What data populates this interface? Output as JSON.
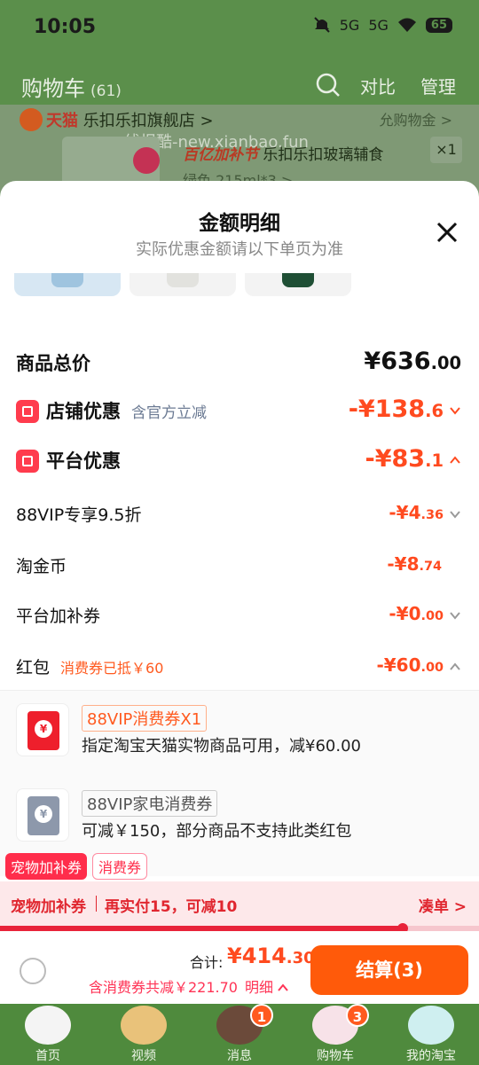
{
  "status_bar": {
    "time": "10:05",
    "signal1": "5G",
    "signal2": "5G",
    "battery": "65"
  },
  "header": {
    "title": "购物车",
    "count": "(61)",
    "compare": "对比",
    "manage": "管理"
  },
  "background_item": {
    "store_brand": "天猫",
    "store_name": "乐扣乐扣旗舰店 >",
    "right_text": "允购物金 >",
    "watermark": "线报酷-new.xianbao.fun",
    "promo": "百亿加补节",
    "product": "乐扣乐扣玻璃辅食",
    "sku": "绿色 215ml*3 >",
    "qty": "×1"
  },
  "sheet": {
    "title": "金额明细",
    "subtitle": "实际优惠金额请以下单页为准",
    "rows": {
      "total": {
        "label": "商品总价",
        "value_int": "¥636",
        "value_dec": ".00"
      },
      "store": {
        "label": "店铺优惠",
        "note": "含官方立减",
        "value_int": "-¥138",
        "value_dec": ".6"
      },
      "platform": {
        "label": "平台优惠",
        "value_int": "-¥83",
        "value_dec": ".1"
      },
      "vip": {
        "label": "88VIP专享9.5折",
        "value_int": "-¥4",
        "value_dec": ".36"
      },
      "coin": {
        "label": "淘金币",
        "value_int": "-¥8",
        "value_dec": ".74"
      },
      "subsidy": {
        "label": "平台加补券",
        "value_int": "-¥0",
        "value_dec": ".00"
      },
      "redpacket": {
        "label": "红包",
        "note": "消费券已抵￥60",
        "value_int": "-¥60",
        "value_dec": ".00"
      }
    },
    "coupons": [
      {
        "tag": "88VIP消费券X1",
        "desc": "指定淘宝天猫实物商品可用，减¥60.00"
      },
      {
        "tag": "88VIP家电消费券",
        "desc": "可减￥150，部分商品不支持此类红包"
      }
    ],
    "tags": {
      "pet": "宠物加补券",
      "consume": "消费券"
    },
    "pet_bar": {
      "left": "宠物加补券",
      "middle": "再实付15，可减10",
      "right": "凑单 >",
      "progress": 0.84
    },
    "checkout": {
      "total_label": "合计:",
      "total_int": "¥414",
      "total_dec": ".30",
      "discount": "含消费券共减￥221.70",
      "detail": "明细",
      "pay": "结算(3)"
    }
  },
  "nav": [
    {
      "label": "首页"
    },
    {
      "label": "视频"
    },
    {
      "label": "消息",
      "badge": "1"
    },
    {
      "label": "购物车",
      "badge": "3"
    },
    {
      "label": "我的淘宝"
    }
  ],
  "colors": {
    "accent": "#ff4a1f",
    "brand_red": "#ff2d4b",
    "header_green": "#5b8f4b",
    "pay_orange": "#ff5a0a"
  }
}
